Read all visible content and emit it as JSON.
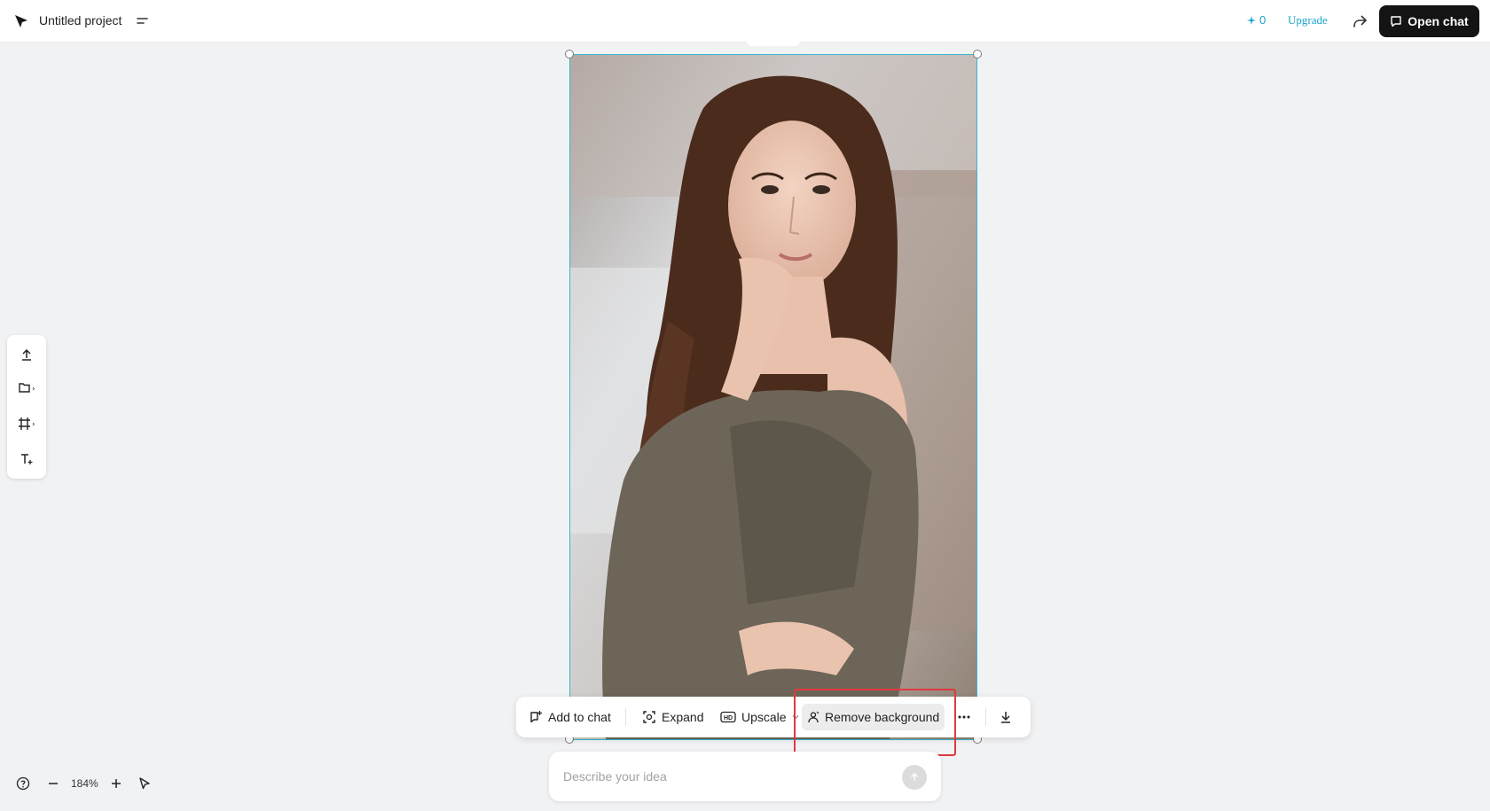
{
  "header": {
    "project_title": "Untitled project",
    "credits": "0",
    "upgrade_label": "Upgrade",
    "open_chat_label": "Open chat"
  },
  "left_toolbar": {
    "items": [
      "upload-icon",
      "folder-add-icon",
      "frame-icon",
      "text-add-icon"
    ]
  },
  "action_bar": {
    "add_to_chat": "Add to chat",
    "expand": "Expand",
    "upscale": "Upscale",
    "remove_background": "Remove background"
  },
  "prompt": {
    "placeholder": "Describe your idea"
  },
  "zoom": {
    "level": "184%"
  },
  "colors": {
    "accent": "#1aa3c8",
    "selection": "#36b6cf",
    "highlight": "#e0393e",
    "open_chat_bg": "#141414"
  }
}
